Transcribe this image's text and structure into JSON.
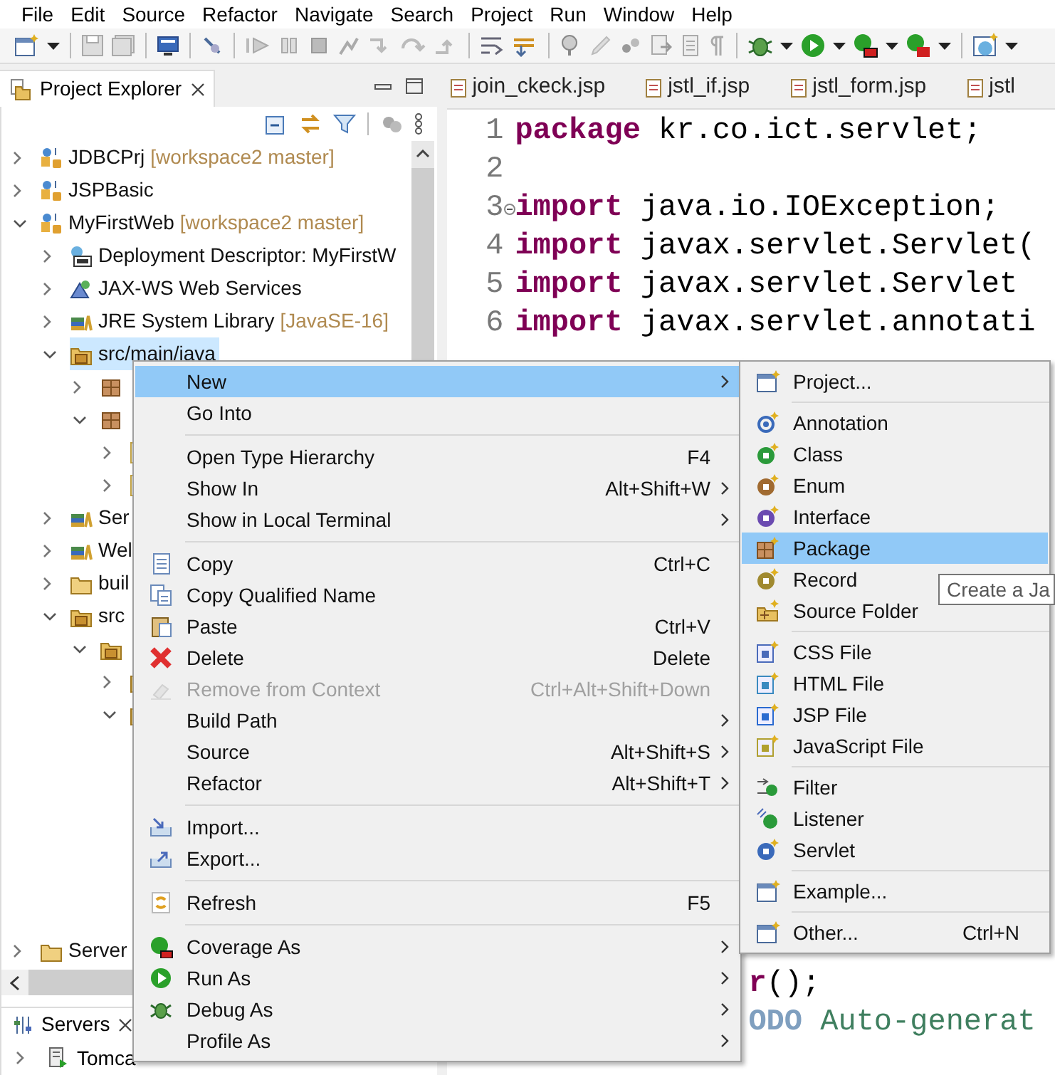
{
  "menu_bar": [
    "File",
    "Edit",
    "Source",
    "Refactor",
    "Navigate",
    "Search",
    "Project",
    "Run",
    "Window",
    "Help"
  ],
  "project_explorer": {
    "title": "Project Explorer",
    "tree": [
      {
        "label": "JDBCPrj",
        "decoration": "[workspace2 master]",
        "expanded": false,
        "selected": false
      },
      {
        "label": "JSPBasic",
        "expanded": false,
        "selected": false
      },
      {
        "label": "MyFirstWeb",
        "decoration": "[workspace2 master]",
        "expanded": true,
        "selected": false,
        "children": [
          {
            "label": "Deployment Descriptor: MyFirstW",
            "expanded": false,
            "selected": false
          },
          {
            "label": "JAX-WS Web Services",
            "expanded": false,
            "selected": false
          },
          {
            "label": "JRE System Library",
            "decoration": "[JavaSE-16]",
            "expanded": false,
            "selected": false
          },
          {
            "label": "src/main/java",
            "expanded": true,
            "selected": true,
            "children": [
              {
                "expanded": false,
                "selected": false
              },
              {
                "expanded": true,
                "selected": false,
                "children": [
                  {
                    "expanded": false,
                    "selected": false
                  },
                  {
                    "expanded": false,
                    "selected": false
                  }
                ]
              }
            ]
          },
          {
            "label": "Ser",
            "expanded": false,
            "selected": false
          },
          {
            "label": "Wel",
            "expanded": false,
            "selected": false
          },
          {
            "label": "buil",
            "expanded": false,
            "selected": false
          },
          {
            "label": "src",
            "expanded": true,
            "selected": false,
            "children": [
              {
                "expanded": true,
                "selected": false,
                "children": [
                  {
                    "expanded": false,
                    "selected": false
                  },
                  {
                    "expanded": true,
                    "selected": false
                  }
                ]
              }
            ]
          }
        ]
      },
      {
        "label": "Server",
        "expanded": false,
        "selected": false
      }
    ]
  },
  "servers_view": {
    "title": "Servers",
    "rows": [
      {
        "label": "Tomca",
        "expanded": false
      }
    ]
  },
  "editor": {
    "tabs": [
      {
        "label": "join_ckeck.jsp",
        "selected": false
      },
      {
        "label": "jstl_if.jsp",
        "selected": false
      },
      {
        "label": "jstl_form.jsp",
        "selected": false
      },
      {
        "label": "jstl",
        "selected": false
      }
    ],
    "lines": [
      {
        "number": "1",
        "fold_marker": false,
        "tokens": [
          {
            "text": "package",
            "kind": "keyword"
          },
          {
            "text": " kr.co.ict.servlet;",
            "kind": "plain"
          }
        ]
      },
      {
        "number": "2",
        "fold_marker": false
      },
      {
        "number": "3",
        "fold_marker": true,
        "tokens": [
          {
            "text": "import",
            "kind": "keyword"
          },
          {
            "text": " java.io.IOException;",
            "kind": "plain"
          }
        ]
      },
      {
        "number": "4",
        "fold_marker": false,
        "tokens": [
          {
            "text": "import",
            "kind": "keyword"
          },
          {
            "text": " javax.servlet.Servlet(",
            "kind": "plain"
          }
        ]
      },
      {
        "number": "5",
        "fold_marker": false,
        "tokens": [
          {
            "text": "import",
            "kind": "keyword"
          },
          {
            "text": " javax.servlet.Servlet",
            "kind": "plain"
          }
        ]
      },
      {
        "number": "6",
        "fold_marker": false,
        "tokens": [
          {
            "text": "import",
            "kind": "keyword"
          },
          {
            "text": " javax.servlet.annotati",
            "kind": "plain"
          }
        ]
      }
    ],
    "fragments": [
      {
        "tokens": [
          {
            "text": "r",
            "kind": "keyword"
          },
          {
            "text": "();",
            "kind": "plain"
          }
        ]
      },
      {
        "tokens": [
          {
            "text": "ODO",
            "kind": "task"
          },
          {
            "text": " Auto-generat",
            "kind": "comment"
          }
        ]
      }
    ]
  },
  "context_menu": {
    "items": [
      {
        "kind": "item",
        "label": "New",
        "submenu": true,
        "selected": true,
        "disabled": false
      },
      {
        "kind": "item",
        "label": "Go Into",
        "submenu": false,
        "selected": false,
        "disabled": false
      },
      {
        "kind": "separator"
      },
      {
        "kind": "item",
        "label": "Open Type Hierarchy",
        "shortcut": "F4",
        "submenu": false,
        "selected": false,
        "disabled": false
      },
      {
        "kind": "item",
        "label": "Show In",
        "shortcut": "Alt+Shift+W",
        "submenu": true,
        "selected": false,
        "disabled": false
      },
      {
        "kind": "item",
        "label": "Show in Local Terminal",
        "submenu": true,
        "selected": false,
        "disabled": false
      },
      {
        "kind": "separator"
      },
      {
        "kind": "item",
        "label": "Copy",
        "shortcut": "Ctrl+C",
        "submenu": false,
        "selected": false,
        "disabled": false
      },
      {
        "kind": "item",
        "label": "Copy Qualified Name",
        "submenu": false,
        "selected": false,
        "disabled": false
      },
      {
        "kind": "item",
        "label": "Paste",
        "shortcut": "Ctrl+V",
        "submenu": false,
        "selected": false,
        "disabled": false
      },
      {
        "kind": "item",
        "label": "Delete",
        "shortcut": "Delete",
        "submenu": false,
        "selected": false,
        "disabled": false
      },
      {
        "kind": "item",
        "label": "Remove from Context",
        "shortcut": "Ctrl+Alt+Shift+Down",
        "submenu": false,
        "selected": false,
        "disabled": true
      },
      {
        "kind": "item",
        "label": "Build Path",
        "submenu": true,
        "selected": false,
        "disabled": false
      },
      {
        "kind": "item",
        "label": "Source",
        "shortcut": "Alt+Shift+S",
        "submenu": true,
        "selected": false,
        "disabled": false
      },
      {
        "kind": "item",
        "label": "Refactor",
        "shortcut": "Alt+Shift+T",
        "submenu": true,
        "selected": false,
        "disabled": false
      },
      {
        "kind": "separator"
      },
      {
        "kind": "item",
        "label": "Import...",
        "submenu": false,
        "selected": false,
        "disabled": false
      },
      {
        "kind": "item",
        "label": "Export...",
        "submenu": false,
        "selected": false,
        "disabled": false
      },
      {
        "kind": "separator"
      },
      {
        "kind": "item",
        "label": "Refresh",
        "shortcut": "F5",
        "submenu": false,
        "selected": false,
        "disabled": false
      },
      {
        "kind": "separator"
      },
      {
        "kind": "item",
        "label": "Coverage As",
        "submenu": true,
        "selected": false,
        "disabled": false
      },
      {
        "kind": "item",
        "label": "Run As",
        "submenu": true,
        "selected": false,
        "disabled": false
      },
      {
        "kind": "item",
        "label": "Debug As",
        "submenu": true,
        "selected": false,
        "disabled": false
      },
      {
        "kind": "item",
        "label": "Profile As",
        "submenu": true,
        "selected": false,
        "disabled": false
      }
    ]
  },
  "new_submenu": {
    "items": [
      {
        "kind": "item",
        "label": "Project...",
        "selected": false
      },
      {
        "kind": "separator"
      },
      {
        "kind": "item",
        "label": "Annotation",
        "selected": false
      },
      {
        "kind": "item",
        "label": "Class",
        "selected": false
      },
      {
        "kind": "item",
        "label": "Enum",
        "selected": false
      },
      {
        "kind": "item",
        "label": "Interface",
        "selected": false
      },
      {
        "kind": "item",
        "label": "Package",
        "selected": true
      },
      {
        "kind": "item",
        "label": "Record",
        "selected": false
      },
      {
        "kind": "item",
        "label": "Source Folder",
        "selected": false
      },
      {
        "kind": "separator"
      },
      {
        "kind": "item",
        "label": "CSS File",
        "selected": false
      },
      {
        "kind": "item",
        "label": "HTML File",
        "selected": false
      },
      {
        "kind": "item",
        "label": "JSP File",
        "selected": false
      },
      {
        "kind": "item",
        "label": "JavaScript File",
        "selected": false
      },
      {
        "kind": "separator"
      },
      {
        "kind": "item",
        "label": "Filter",
        "selected": false
      },
      {
        "kind": "item",
        "label": "Listener",
        "selected": false
      },
      {
        "kind": "item",
        "label": "Servlet",
        "selected": false
      },
      {
        "kind": "separator"
      },
      {
        "kind": "item",
        "label": "Example...",
        "selected": false
      },
      {
        "kind": "separator"
      },
      {
        "kind": "item",
        "label": "Other...",
        "shortcut": "Ctrl+N",
        "selected": false
      }
    ]
  },
  "tooltip": "Create a Ja"
}
